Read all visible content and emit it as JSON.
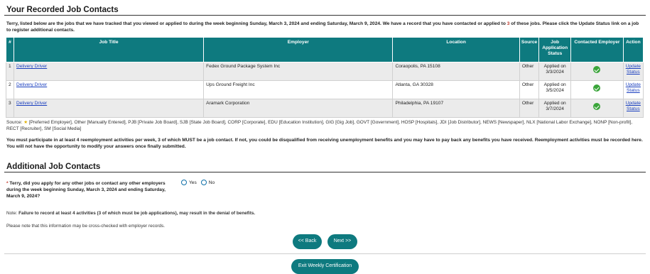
{
  "recorded": {
    "title": "Your Recorded Job Contacts",
    "intro_before": "Terry, listed below are the jobs that we have tracked that you viewed or applied to during the week beginning Sunday, March 3, 2024 and ending Saturday, March 9, 2024. We have a record that you have contacted or applied to ",
    "intro_count": "3",
    "intro_after": " of these jobs. Please click the Update Status link on a job to register additional contacts."
  },
  "table": {
    "headers": {
      "num": "#",
      "job_title": "Job Title",
      "employer": "Employer",
      "location": "Location",
      "source": "Source",
      "status": "Job Application Status",
      "contacted": "Contacted Employer",
      "action": "Action"
    },
    "rows": [
      {
        "num": "1",
        "job_title": "Delivery Driver",
        "employer": "Fedex Ground Package System Inc",
        "location": "Coraopolis, PA 15108",
        "source": "Other",
        "status": "Applied on 3/3/2024",
        "contacted": true,
        "action": "Update Status"
      },
      {
        "num": "2",
        "job_title": "Delivery Driver",
        "employer": "Ups Ground Freight Inc",
        "location": "Atlanta, GA 30328",
        "source": "Other",
        "status": "Applied on 3/5/2024",
        "contacted": true,
        "action": "Update Status"
      },
      {
        "num": "3",
        "job_title": "Delivery Driver",
        "employer": "Aramark Corporation",
        "location": "Philadelphia, PA 19107",
        "source": "Other",
        "status": "Applied on 3/7/2024",
        "contacted": true,
        "action": "Update Status"
      }
    ]
  },
  "legend": {
    "prefix": "Source:",
    "text": "[Preferred Employer], Other [Manually Entered], PJB [Private Job Board], SJB [State Job Board], CORP [Corporate], EDU [Education Institution], GIG [Gig Job], GOVT [Government], HOSP [Hospitals], JDI [Job Distributor], NEWS [Newspaper], NLX [National Labor Exchange], NONP [Non-profit], RECT [Recruiter], SM [Social Media]"
  },
  "warning": {
    "before": "You must participate in at least 4 reemployment activities per week, 3 of which MUST be a job contact. If not, you could be ",
    "emphasis": "disqualified from receiving unemployment benefits",
    "after": " and you may have to pay back any benefits you have received. Reemployment activities must be recorded here. You will not have the opportunity to modify your answers once finally submitted."
  },
  "additional": {
    "title": "Additional Job Contacts",
    "required_mark": "*",
    "question": "Terry, did you apply for any other jobs or contact any other employers during the week beginning Sunday, March 3, 2024 and ending Saturday, March 9, 2024?",
    "yes": "Yes",
    "no": "No",
    "note_label": "Note:",
    "note_text": "Failure to record at least 4 activities (3 of which must be job applications), may result in the denial of benefits.",
    "crosscheck": "Please note that this information may be cross-checked with employer records."
  },
  "buttons": {
    "back": "<< Back",
    "next": "Next >>",
    "exit": "Exit Weekly Certification"
  },
  "colors": {
    "accent": "#0e7a7f",
    "link": "#1a3fbf",
    "check": "#3aa53a",
    "required": "#c0392b"
  }
}
